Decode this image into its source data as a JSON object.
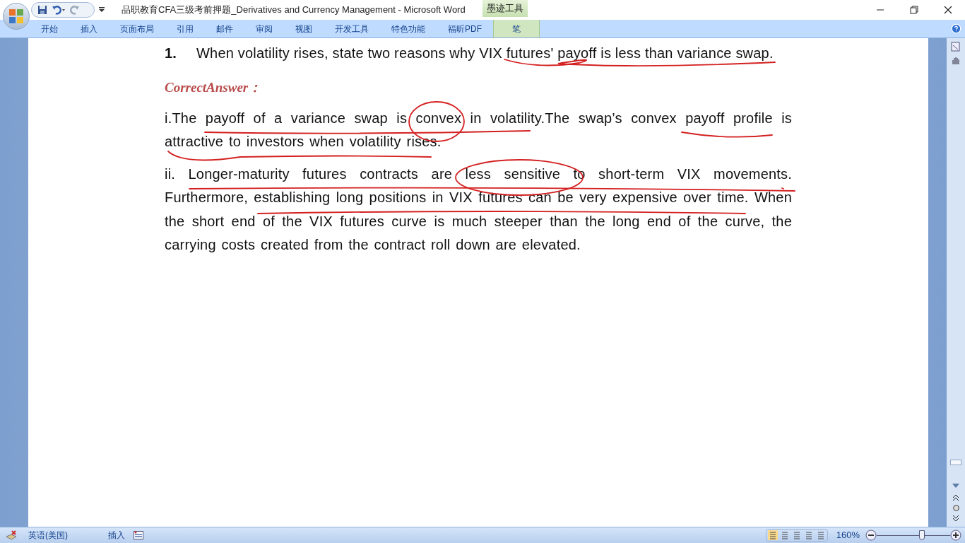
{
  "window": {
    "title": "品职教育CFA三级考前押题_Derivatives and Currency Management - Microsoft Word",
    "contextual_group": "墨迹工具"
  },
  "ribbon_tabs": [
    {
      "label": "开始",
      "kind": "main"
    },
    {
      "label": "插入",
      "kind": "main"
    },
    {
      "label": "页面布局",
      "kind": "main"
    },
    {
      "label": "引用",
      "kind": "main"
    },
    {
      "label": "邮件",
      "kind": "main"
    },
    {
      "label": "审阅",
      "kind": "main"
    },
    {
      "label": "视图",
      "kind": "main"
    },
    {
      "label": "开发工具",
      "kind": "main"
    },
    {
      "label": "特色功能",
      "kind": "main"
    },
    {
      "label": "福昕PDF",
      "kind": "main"
    },
    {
      "label": "笔",
      "kind": "contextual"
    }
  ],
  "document": {
    "question_number": "1.",
    "question": "When volatility rises, state two reasons why VIX futures' payoff is less than variance swap.",
    "answer_label": "CorrectAnswer：",
    "paragraphs": [
      "i.The payoff of a variance swap is convex in volatility.The swap’s convex payoff profile is attractive to investors when volatility rises.",
      "ii. Longer-maturity futures contracts are less sensitive to short-term VIX movements. Furthermore, establishing long positions in VIX futures can be very expensive over time. When the short end of the VIX futures curve is much steeper than the long end of the curve, the carrying costs created from the contract roll down are elevated."
    ]
  },
  "status_bar": {
    "language": "英语(美国)",
    "mode": "插入",
    "zoom": "160%",
    "zoom_slider": {
      "level": 0.62
    }
  }
}
